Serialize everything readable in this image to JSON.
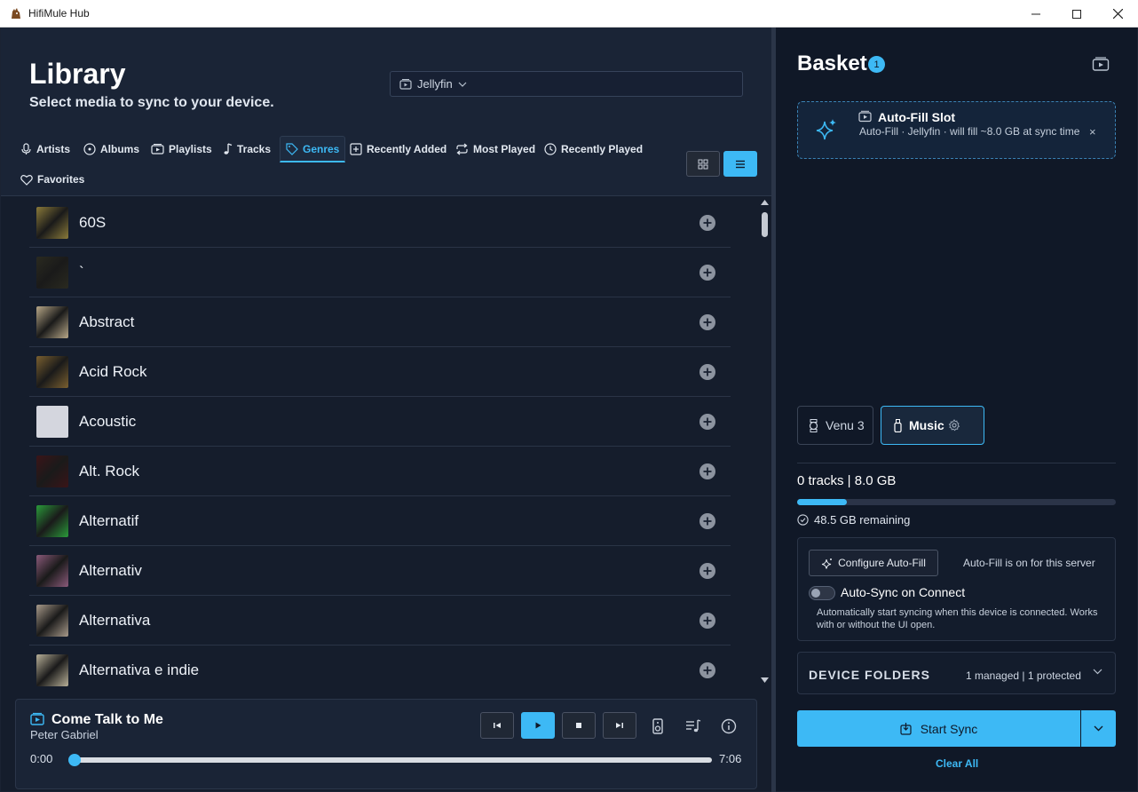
{
  "window": {
    "title": "HifiMule Hub"
  },
  "library": {
    "title": "Library",
    "subtitle": "Select media to sync to your device.",
    "source": "Jellyfin"
  },
  "tabs": [
    {
      "label": "Artists",
      "icon": "mic-icon"
    },
    {
      "label": "Albums",
      "icon": "disc-icon"
    },
    {
      "label": "Playlists",
      "icon": "playlist-icon"
    },
    {
      "label": "Tracks",
      "icon": "music-note-icon"
    },
    {
      "label": "Genres",
      "icon": "tag-icon",
      "active": true
    },
    {
      "label": "Recently Added",
      "icon": "plus-square-icon"
    },
    {
      "label": "Most Played",
      "icon": "repeat-icon"
    },
    {
      "label": "Recently Played",
      "icon": "clock-icon"
    },
    {
      "label": "Favorites",
      "icon": "heart-icon"
    }
  ],
  "genres": [
    {
      "name": "60S",
      "color": "#8a7a3a"
    },
    {
      "name": "`",
      "color": "#2a2a20"
    },
    {
      "name": "Abstract",
      "color": "#b8a888"
    },
    {
      "name": "Acid Rock",
      "color": "#7a6030"
    },
    {
      "name": "Acoustic",
      "color": "#d4d6de"
    },
    {
      "name": "Alt. Rock",
      "color": "#3a1418"
    },
    {
      "name": "Alternatif",
      "color": "#2a9a3a"
    },
    {
      "name": "Alternativ",
      "color": "#8a5a7a"
    },
    {
      "name": "Alternativa",
      "color": "#a89a8a"
    },
    {
      "name": "Alternativa e indie",
      "color": "#b8b098"
    }
  ],
  "player": {
    "title": "Come Talk to Me",
    "artist": "Peter Gabriel",
    "elapsed": "0:00",
    "duration": "7:06",
    "progress": 0
  },
  "basket": {
    "title": "Basket",
    "count": "1",
    "autofill": {
      "title": "Auto-Fill Slot",
      "description": "Auto-Fill · Jellyfin · will fill ~8.0 GB at sync time",
      "close": "×"
    },
    "devices": [
      {
        "label": "Venu 3",
        "icon": "watch-icon"
      },
      {
        "label": "Music",
        "icon": "usb-drive-icon",
        "active": true
      }
    ],
    "stats": "0 tracks | 8.0 GB",
    "usage_fraction": 0.155,
    "remaining": "48.5 GB remaining",
    "configure_label": "Configure Auto-Fill",
    "autofill_status": "Auto-Fill is on for this server",
    "autosync_label": "Auto-Sync on Connect",
    "autosync_on": false,
    "autosync_desc": "Automatically start syncing when this device is connected. Works with or without the UI open.",
    "folders_label": "DEVICE FOLDERS",
    "folders_summary": "1 managed | 1 protected",
    "sync_label": "Start Sync",
    "clear_label": "Clear All"
  },
  "colors": {
    "accent": "#3db9f5",
    "background": "#151d2c",
    "panel": "#101827"
  }
}
